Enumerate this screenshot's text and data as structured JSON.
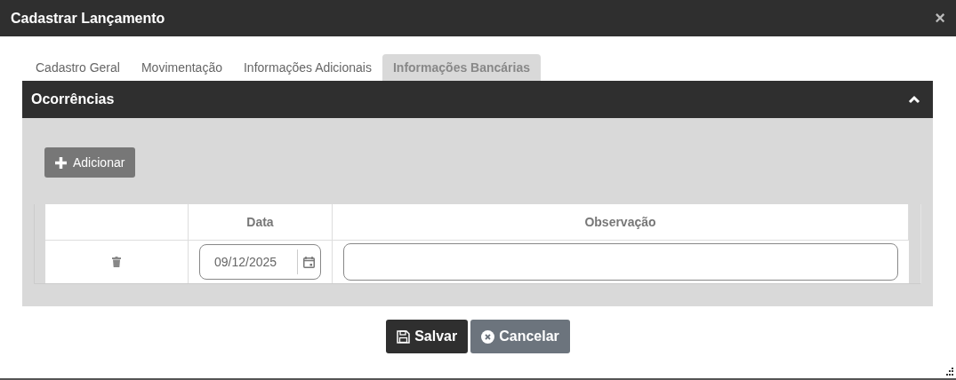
{
  "window": {
    "title": "Cadastrar Lançamento",
    "close": "×"
  },
  "tabs": [
    {
      "label": "Cadastro Geral",
      "selected": false
    },
    {
      "label": "Movimentação",
      "selected": false
    },
    {
      "label": "Informações Adicionais",
      "selected": false
    },
    {
      "label": "Informações Bancárias",
      "selected": true
    }
  ],
  "section": {
    "title": "Ocorrências",
    "expanded": true,
    "add_button": "Adicionar",
    "table": {
      "columns": [
        "",
        "Data",
        "Observação"
      ],
      "rows": [
        {
          "date": "09/12/2025",
          "observation": ""
        }
      ]
    }
  },
  "buttons": [
    {
      "kind": "save",
      "label": "Salvar"
    },
    {
      "kind": "cancel",
      "label": "Cancelar"
    }
  ]
}
